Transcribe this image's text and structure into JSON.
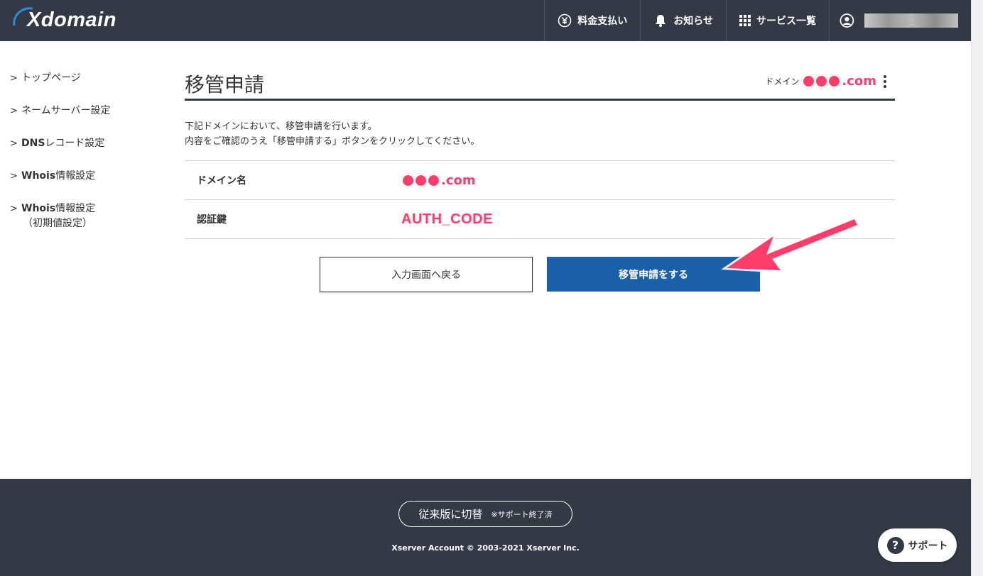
{
  "header": {
    "logo": "Xdomain",
    "nav": [
      {
        "label": "料金支払い",
        "icon": "yen-icon"
      },
      {
        "label": "お知らせ",
        "icon": "bell-icon"
      },
      {
        "label": "サービス一覧",
        "icon": "grid-icon"
      }
    ]
  },
  "sidebar": {
    "items": [
      {
        "label": "トップページ"
      },
      {
        "label": "ネームサーバー設定"
      },
      {
        "bold": "DNS",
        "label": "レコード設定"
      },
      {
        "bold": "Whois",
        "label": "情報設定"
      },
      {
        "bold": "Whois",
        "label": "情報設定",
        "sub": "（初期値設定）"
      }
    ]
  },
  "main": {
    "title": "移管申請",
    "domain_label": "ドメイン",
    "domain_suffix": ".com",
    "desc_line1": "下記ドメインにおいて、移管申請を行います。",
    "desc_line2": "内容をご確認のうえ「移管申請する」ボタンをクリックしてください。",
    "rows": [
      {
        "label": "ドメイン名",
        "value": ".com"
      },
      {
        "label": "認証鍵",
        "value": "AUTH_CODE"
      }
    ],
    "back_button": "入力画面へ戻る",
    "submit_button": "移管申請をする"
  },
  "footer": {
    "legacy_button": "従来版に切替",
    "legacy_note": "※サポート終了済",
    "copyright": "Xserver Account © 2003-2021 Xserver Inc."
  },
  "support": {
    "label": "サポート"
  },
  "colors": {
    "header": "#343a45",
    "primary": "#1a5fa8",
    "accent": "#ff3d6b"
  }
}
